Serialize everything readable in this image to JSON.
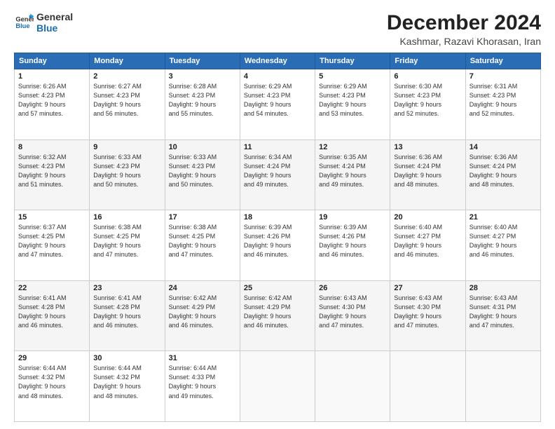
{
  "header": {
    "logo_line1": "General",
    "logo_line2": "Blue",
    "title": "December 2024",
    "subtitle": "Kashmar, Razavi Khorasan, Iran"
  },
  "columns": [
    "Sunday",
    "Monday",
    "Tuesday",
    "Wednesday",
    "Thursday",
    "Friday",
    "Saturday"
  ],
  "weeks": [
    [
      {
        "day": "1",
        "sunrise": "6:26 AM",
        "sunset": "4:23 PM",
        "daylight": "9 hours and 57 minutes."
      },
      {
        "day": "2",
        "sunrise": "6:27 AM",
        "sunset": "4:23 PM",
        "daylight": "9 hours and 56 minutes."
      },
      {
        "day": "3",
        "sunrise": "6:28 AM",
        "sunset": "4:23 PM",
        "daylight": "9 hours and 55 minutes."
      },
      {
        "day": "4",
        "sunrise": "6:29 AM",
        "sunset": "4:23 PM",
        "daylight": "9 hours and 54 minutes."
      },
      {
        "day": "5",
        "sunrise": "6:29 AM",
        "sunset": "4:23 PM",
        "daylight": "9 hours and 53 minutes."
      },
      {
        "day": "6",
        "sunrise": "6:30 AM",
        "sunset": "4:23 PM",
        "daylight": "9 hours and 52 minutes."
      },
      {
        "day": "7",
        "sunrise": "6:31 AM",
        "sunset": "4:23 PM",
        "daylight": "9 hours and 52 minutes."
      }
    ],
    [
      {
        "day": "8",
        "sunrise": "6:32 AM",
        "sunset": "4:23 PM",
        "daylight": "9 hours and 51 minutes."
      },
      {
        "day": "9",
        "sunrise": "6:33 AM",
        "sunset": "4:23 PM",
        "daylight": "9 hours and 50 minutes."
      },
      {
        "day": "10",
        "sunrise": "6:33 AM",
        "sunset": "4:23 PM",
        "daylight": "9 hours and 50 minutes."
      },
      {
        "day": "11",
        "sunrise": "6:34 AM",
        "sunset": "4:24 PM",
        "daylight": "9 hours and 49 minutes."
      },
      {
        "day": "12",
        "sunrise": "6:35 AM",
        "sunset": "4:24 PM",
        "daylight": "9 hours and 49 minutes."
      },
      {
        "day": "13",
        "sunrise": "6:36 AM",
        "sunset": "4:24 PM",
        "daylight": "9 hours and 48 minutes."
      },
      {
        "day": "14",
        "sunrise": "6:36 AM",
        "sunset": "4:24 PM",
        "daylight": "9 hours and 48 minutes."
      }
    ],
    [
      {
        "day": "15",
        "sunrise": "6:37 AM",
        "sunset": "4:25 PM",
        "daylight": "9 hours and 47 minutes."
      },
      {
        "day": "16",
        "sunrise": "6:38 AM",
        "sunset": "4:25 PM",
        "daylight": "9 hours and 47 minutes."
      },
      {
        "day": "17",
        "sunrise": "6:38 AM",
        "sunset": "4:25 PM",
        "daylight": "9 hours and 47 minutes."
      },
      {
        "day": "18",
        "sunrise": "6:39 AM",
        "sunset": "4:26 PM",
        "daylight": "9 hours and 46 minutes."
      },
      {
        "day": "19",
        "sunrise": "6:39 AM",
        "sunset": "4:26 PM",
        "daylight": "9 hours and 46 minutes."
      },
      {
        "day": "20",
        "sunrise": "6:40 AM",
        "sunset": "4:27 PM",
        "daylight": "9 hours and 46 minutes."
      },
      {
        "day": "21",
        "sunrise": "6:40 AM",
        "sunset": "4:27 PM",
        "daylight": "9 hours and 46 minutes."
      }
    ],
    [
      {
        "day": "22",
        "sunrise": "6:41 AM",
        "sunset": "4:28 PM",
        "daylight": "9 hours and 46 minutes."
      },
      {
        "day": "23",
        "sunrise": "6:41 AM",
        "sunset": "4:28 PM",
        "daylight": "9 hours and 46 minutes."
      },
      {
        "day": "24",
        "sunrise": "6:42 AM",
        "sunset": "4:29 PM",
        "daylight": "9 hours and 46 minutes."
      },
      {
        "day": "25",
        "sunrise": "6:42 AM",
        "sunset": "4:29 PM",
        "daylight": "9 hours and 46 minutes."
      },
      {
        "day": "26",
        "sunrise": "6:43 AM",
        "sunset": "4:30 PM",
        "daylight": "9 hours and 47 minutes."
      },
      {
        "day": "27",
        "sunrise": "6:43 AM",
        "sunset": "4:30 PM",
        "daylight": "9 hours and 47 minutes."
      },
      {
        "day": "28",
        "sunrise": "6:43 AM",
        "sunset": "4:31 PM",
        "daylight": "9 hours and 47 minutes."
      }
    ],
    [
      {
        "day": "29",
        "sunrise": "6:44 AM",
        "sunset": "4:32 PM",
        "daylight": "9 hours and 48 minutes."
      },
      {
        "day": "30",
        "sunrise": "6:44 AM",
        "sunset": "4:32 PM",
        "daylight": "9 hours and 48 minutes."
      },
      {
        "day": "31",
        "sunrise": "6:44 AM",
        "sunset": "4:33 PM",
        "daylight": "9 hours and 49 minutes."
      },
      null,
      null,
      null,
      null
    ]
  ]
}
